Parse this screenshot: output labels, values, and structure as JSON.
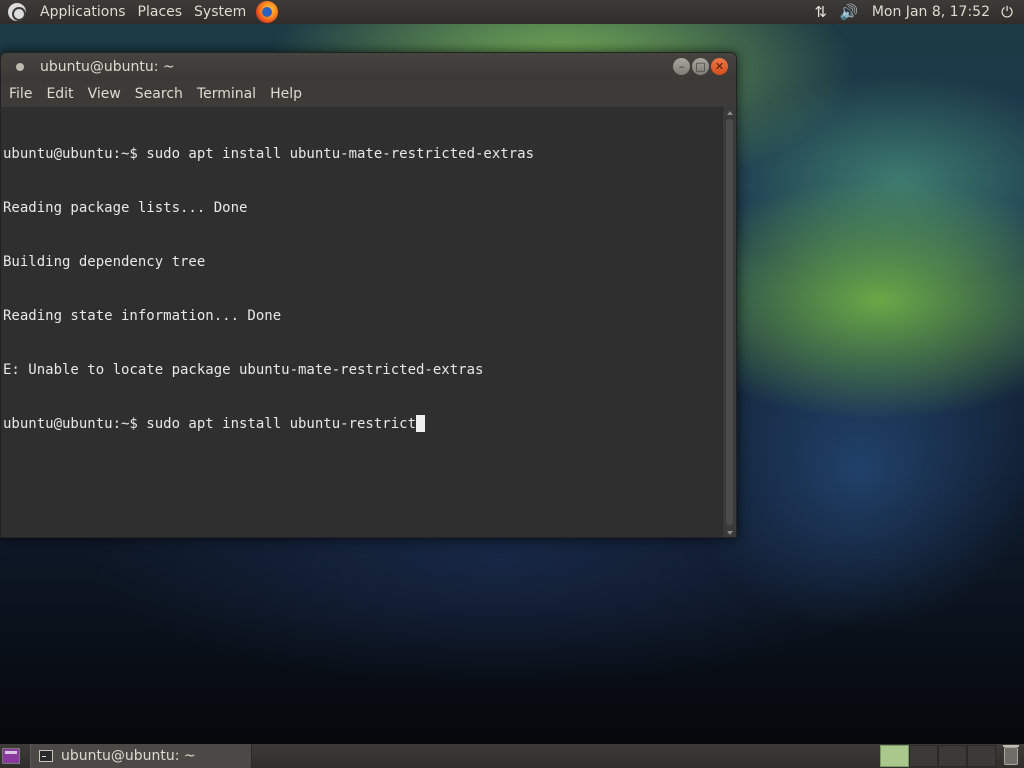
{
  "top_panel": {
    "menus": [
      "Applications",
      "Places",
      "System"
    ],
    "clock": "Mon Jan 8, 17:52"
  },
  "window": {
    "title": "ubuntu@ubuntu: ~",
    "menubar": [
      "File",
      "Edit",
      "View",
      "Search",
      "Terminal",
      "Help"
    ]
  },
  "terminal": {
    "lines": [
      "ubuntu@ubuntu:~$ sudo apt install ubuntu-mate-restricted-extras",
      "Reading package lists... Done",
      "Building dependency tree",
      "Reading state information... Done",
      "E: Unable to locate package ubuntu-mate-restricted-extras",
      "ubuntu@ubuntu:~$ sudo apt install ubuntu-restrict"
    ]
  },
  "bottom_panel": {
    "task_label": "ubuntu@ubuntu: ~",
    "workspaces": 4,
    "active_workspace": 1
  },
  "colors": {
    "panel": "#3c3b37",
    "terminal_bg": "#2f2f2f",
    "close_button": "#e05a24",
    "active_workspace": "#a8c88c"
  }
}
